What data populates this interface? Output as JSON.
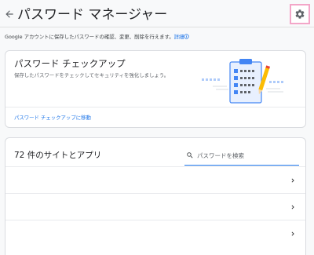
{
  "header": {
    "title": "パスワード マネージャー",
    "back_icon": "arrow-back-icon",
    "settings_icon": "gear-icon",
    "settings_highlight_color": "#f3a6c8"
  },
  "description": {
    "text": "Google アカウントに保存したパスワードの確認、変更、削除を行えます。",
    "link_label": "詳細"
  },
  "checkup": {
    "title": "パスワード チェックアップ",
    "subtitle": "保存したパスワードをチェックしてセキュリティを強化しましょう。",
    "link_label": "パスワード チェックアップに移動",
    "illustration": "clipboard-checklist-illustration"
  },
  "sites": {
    "title": "72 件のサイトとアプリ",
    "search_placeholder": "パスワードを検索",
    "search_value": "",
    "rows": [
      {
        "id": "row-1"
      },
      {
        "id": "row-2"
      },
      {
        "id": "row-3"
      }
    ]
  },
  "colors": {
    "accent": "#1a73e8",
    "background": "#f8f9fa",
    "card": "#ffffff",
    "border": "#dadce0"
  }
}
